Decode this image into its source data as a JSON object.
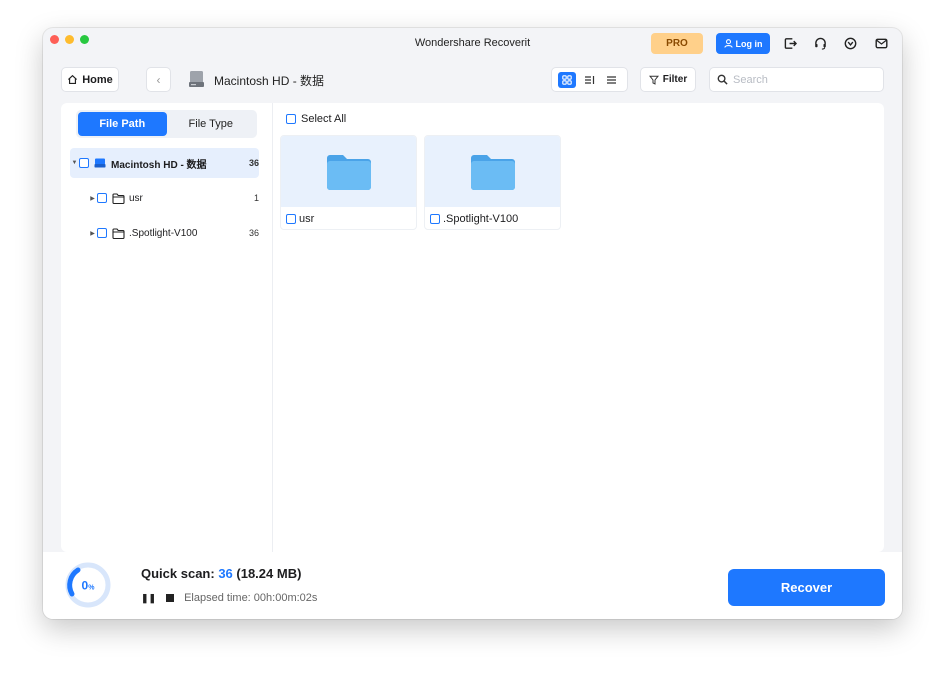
{
  "window": {
    "title": "Wondershare Recoverit"
  },
  "titlebar": {
    "pro_label": "PRO",
    "login_label": "Log in"
  },
  "toolbar": {
    "home_label": "Home",
    "breadcrumb": "Macintosh HD - 数据",
    "filter_label": "Filter",
    "search_placeholder": "Search"
  },
  "sidebar": {
    "tabs": [
      {
        "label": "File Path",
        "active": true
      },
      {
        "label": "File Type",
        "active": false
      }
    ],
    "tree": [
      {
        "name": "Macintosh HD - 数据",
        "count": "36",
        "level": 0,
        "icon": "drive-icon",
        "expanded": true,
        "selected": true
      },
      {
        "name": "usr",
        "count": "1",
        "level": 1,
        "icon": "folder-icon",
        "expanded": false,
        "selected": false
      },
      {
        "name": ".Spotlight-V100",
        "count": "36",
        "level": 1,
        "icon": "folder-icon",
        "expanded": false,
        "selected": false
      }
    ]
  },
  "main": {
    "select_all_label": "Select All",
    "items": [
      {
        "name": "usr",
        "icon": "folder-icon"
      },
      {
        "name": ".Spotlight-V100",
        "icon": "folder-icon"
      }
    ]
  },
  "footer": {
    "progress_label": "0",
    "progress_unit": "%",
    "progress_value": 0,
    "scan_prefix": "Quick scan: ",
    "scan_count": "36",
    "scan_size": " (18.24 MB)",
    "elapsed_label": "Elapsed time: 00h:00m:02s",
    "recover_label": "Recover"
  },
  "colors": {
    "accent": "#1e78ff",
    "pro_bg": "#ffd08a",
    "folder": "#5eb1f0"
  }
}
